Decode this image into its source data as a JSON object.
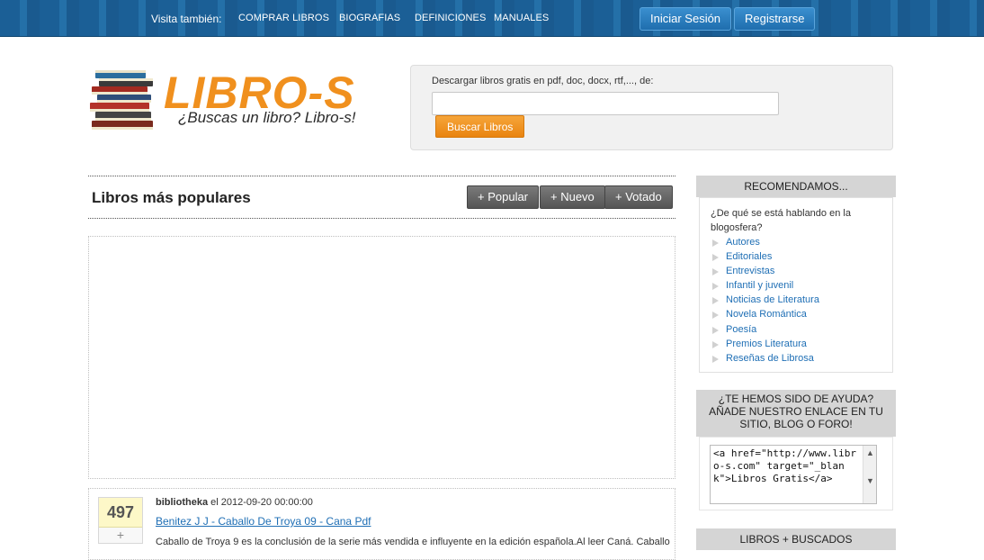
{
  "topbar": {
    "visit_label": "Visita también:",
    "links": [
      "COMPRAR LIBROS",
      "BIOGRAFIAS",
      "DEFINICIONES",
      "MANUALES"
    ],
    "login_label": "Iniciar Sesión",
    "register_label": "Registrarse"
  },
  "logo": {
    "text": "LIBRO-S",
    "tagline": "¿Buscas un libro? Libro-s!"
  },
  "search": {
    "label": "Descargar libros gratis en pdf, doc, docx, rtf,..., de:",
    "value": "",
    "button_label": "Buscar Libros"
  },
  "main": {
    "section_title": "Libros más populares",
    "tabs": [
      "+ Popular",
      "+ Nuevo",
      "+ Votado"
    ],
    "items": [
      {
        "votes": "497",
        "vote_plus": "+",
        "user": "bibliotheka",
        "date_prefix": "el",
        "date": "2012-09-20 00:00:00",
        "title": "Benitez J J - Caballo De Troya 09 - Cana Pdf",
        "desc": "Caballo de Troya 9 es la conclusión de la serie más vendida e influyente en la edición española.Al leer Caná. Caballo"
      }
    ]
  },
  "sidebar": {
    "recommend_title": "RECOMENDAMOS...",
    "recommend_intro": "¿De qué se está hablando en la blogosfera?",
    "recommend_links": [
      "Autores",
      "Editoriales",
      "Entrevistas",
      "Infantil y juvenil",
      "Noticias de Literatura",
      "Novela Romántica",
      "Poesía",
      "Premios Literatura",
      "Reseñas de Librosa"
    ],
    "link_title": "¿TE HEMOS SIDO DE AYUDA? AÑADE NUESTRO ENLACE EN TU SITIO, BLOG O FORO!",
    "link_code": "<a href=\"http://www.libro-s.com\" target=\"_blank\">Libros Gratis</a>",
    "searched_title": "LIBROS + BUSCADOS"
  },
  "colors": {
    "topbar": "#1b5f96",
    "accent_orange": "#f0901e",
    "link_blue": "#1f6fb5"
  }
}
